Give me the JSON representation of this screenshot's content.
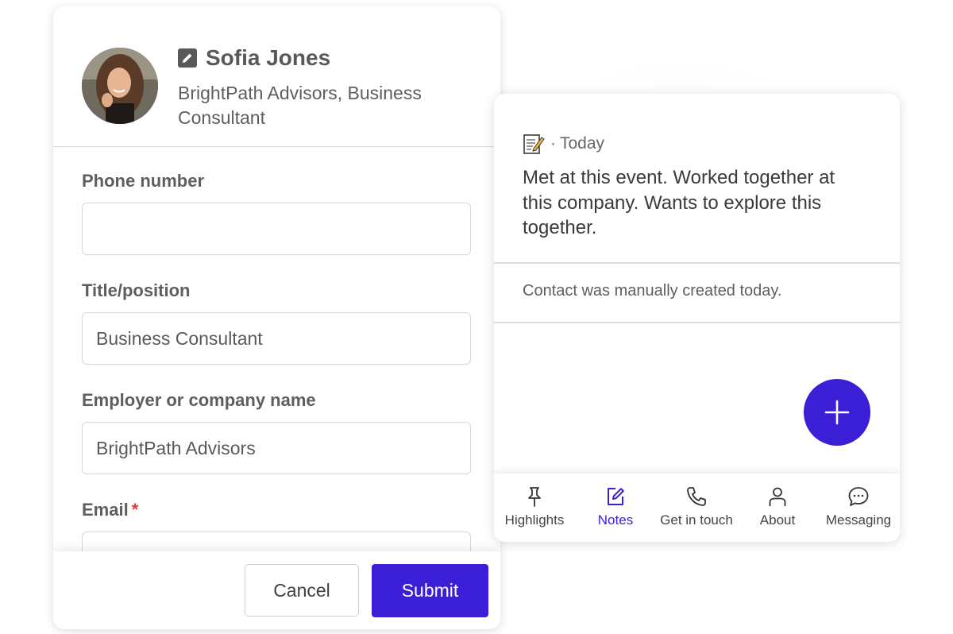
{
  "contact": {
    "name": "Sofia Jones",
    "company_line": "BrightPath Advisors, Business Consultant"
  },
  "form": {
    "phone": {
      "label": "Phone number",
      "value": ""
    },
    "title": {
      "label": "Title/position",
      "value": "Business Consultant"
    },
    "employer": {
      "label": "Employer or company name",
      "value": "BrightPath Advisors"
    },
    "email": {
      "label": "Email",
      "required_mark": "*",
      "value": ""
    },
    "cancel_label": "Cancel",
    "submit_label": "Submit"
  },
  "note": {
    "icon": "memo-icon",
    "separator": "·",
    "date": "Today",
    "text": "Met at this event. Worked together at this company. Wants to explore this together."
  },
  "activity": "Contact was manually created today.",
  "add_button": {
    "icon": "plus-icon"
  },
  "tabs": [
    {
      "label": "Highlights",
      "icon": "pin-icon",
      "active": false
    },
    {
      "label": "Notes",
      "icon": "edit-note-icon",
      "active": true
    },
    {
      "label": "Get in touch",
      "icon": "phone-icon",
      "active": false
    },
    {
      "label": "About",
      "icon": "person-icon",
      "active": false
    },
    {
      "label": "Messaging",
      "icon": "chat-bubble-icon",
      "active": false
    }
  ],
  "colors": {
    "accent": "#3a1fd6",
    "required": "#e23b3b",
    "label_text": "#5e5e5e",
    "border": "#d9d9d9"
  }
}
